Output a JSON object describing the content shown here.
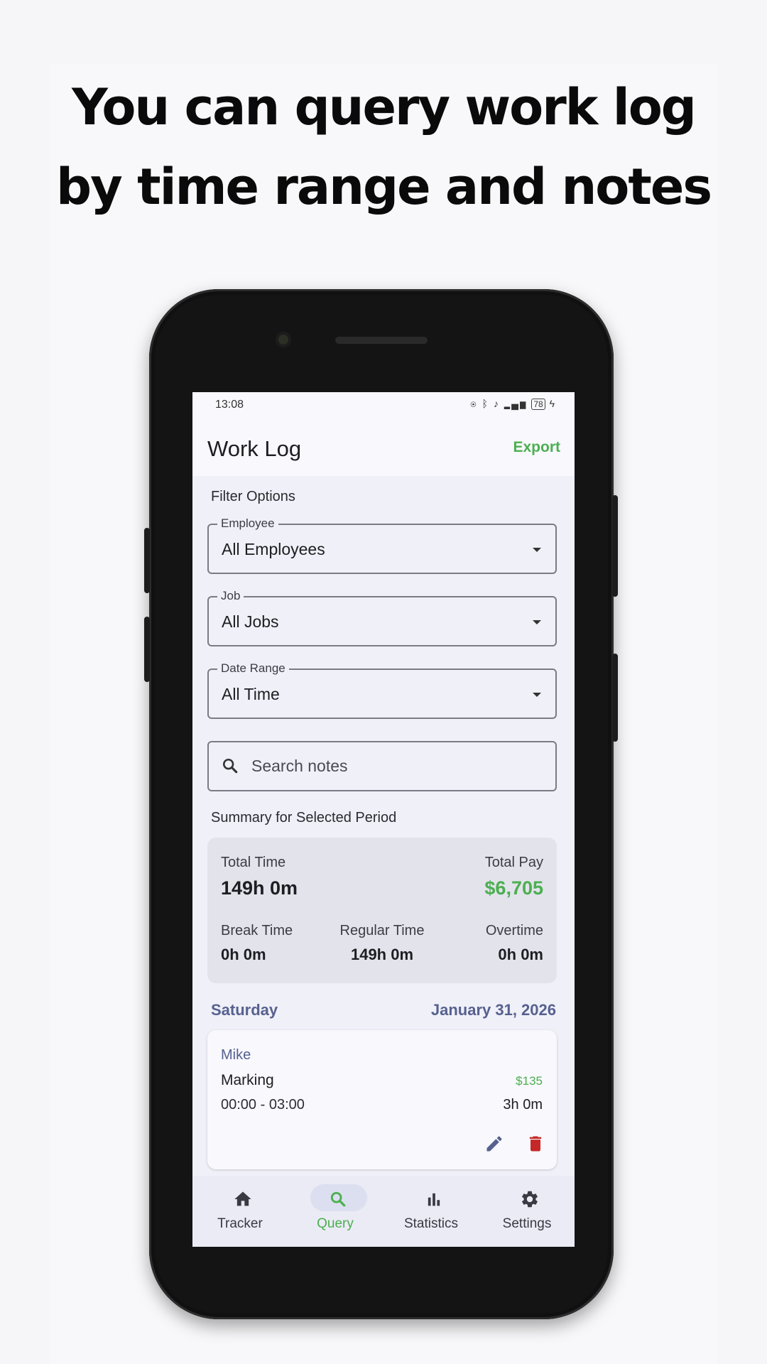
{
  "headline": {
    "line1": "You can query work log",
    "line2": "by time range and notes"
  },
  "status_bar": {
    "time": "13:08",
    "battery": "78"
  },
  "app_bar": {
    "title": "Work Log",
    "export_label": "Export"
  },
  "filters": {
    "section_label": "Filter Options",
    "employee": {
      "label": "Employee",
      "value": "All Employees"
    },
    "job": {
      "label": "Job",
      "value": "All Jobs"
    },
    "date_range": {
      "label": "Date Range",
      "value": "All Time"
    },
    "search": {
      "placeholder": "Search notes"
    }
  },
  "summary": {
    "section_label": "Summary for Selected Period",
    "total_time_label": "Total Time",
    "total_time_value": "149h 0m",
    "total_pay_label": "Total Pay",
    "total_pay_value": "$6,705",
    "break_time_label": "Break Time",
    "break_time_value": "0h 0m",
    "regular_time_label": "Regular Time",
    "regular_time_value": "149h 0m",
    "overtime_label": "Overtime",
    "overtime_value": "0h 0m"
  },
  "day_group": {
    "day": "Saturday",
    "date": "January 31, 2026"
  },
  "entry": {
    "employee": "Mike",
    "job": "Marking",
    "time_range": "00:00 - 03:00",
    "pay": "$135",
    "duration": "3h 0m"
  },
  "bottom_nav": {
    "items": [
      {
        "label": "Tracker",
        "icon": "home-icon",
        "active": false
      },
      {
        "label": "Query",
        "icon": "search-icon",
        "active": true
      },
      {
        "label": "Statistics",
        "icon": "bar-chart-icon",
        "active": false
      },
      {
        "label": "Settings",
        "icon": "gear-icon",
        "active": false
      }
    ]
  },
  "colors": {
    "accent_green": "#4caf50",
    "indigo_text": "#56618f",
    "delete_red": "#c62828",
    "screen_bg": "#f0f0f8"
  }
}
